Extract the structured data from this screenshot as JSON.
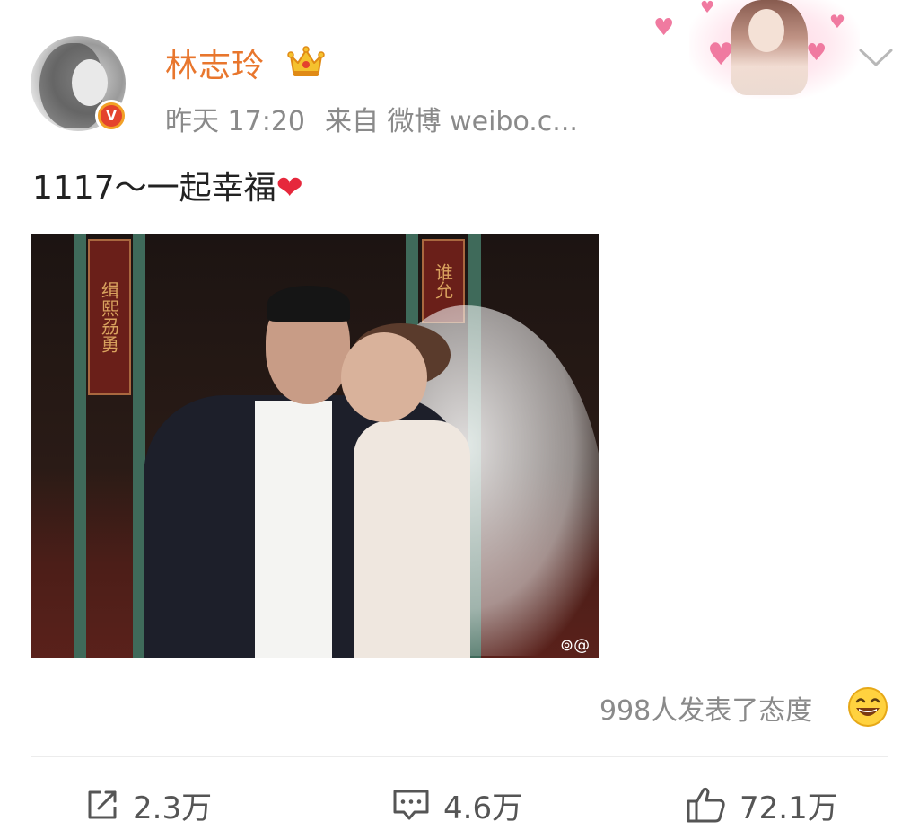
{
  "post": {
    "username": "林志玲",
    "time": "昨天 17:20",
    "source": "来自 微博 weibo.c...",
    "text": "1117～一起幸福",
    "text_emoji": "❤",
    "verified_mark": "V",
    "reactions_text": "998人发表了态度"
  },
  "actions": {
    "repost_count": "2.3万",
    "comment_count": "4.6万",
    "like_count": "72.1万"
  },
  "image": {
    "plaque_left": "缉熙刕勇",
    "plaque_right": "谁允",
    "watermark": "⊚@"
  },
  "icons": {
    "crown": "crown-icon",
    "chevron": "chevron-down-icon",
    "smiley": "laughing-emoji-icon",
    "repost": "repost-icon",
    "comment": "comment-icon",
    "like": "thumbs-up-icon"
  },
  "colors": {
    "username": "#e8762d",
    "meta": "#8a8a8a",
    "verify_badge": "#e4432d",
    "heart": "#e6283c"
  }
}
